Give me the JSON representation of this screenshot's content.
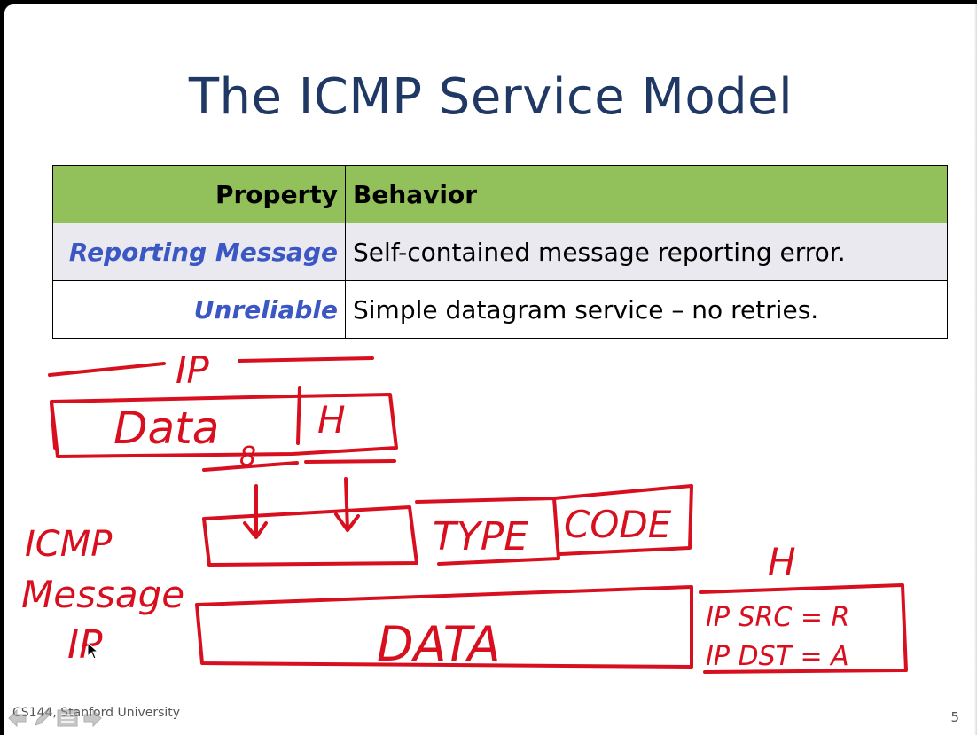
{
  "slide": {
    "title": "The ICMP Service Model",
    "table": {
      "headers": [
        "Property",
        "Behavior"
      ],
      "rows": [
        {
          "property": "Reporting Message",
          "behavior": "Self-contained message reporting error."
        },
        {
          "property": "Unreliable",
          "behavior": "Simple datagram service – no retries."
        }
      ]
    },
    "footer": "CS144, Stanford University",
    "page_number": "5"
  },
  "colors": {
    "title": "#1f3864",
    "header_bg": "#92c05a",
    "property_text": "#3b57c4",
    "row_shade": "#e9e9ef",
    "ink": "#d80f1e"
  },
  "annotations": {
    "ip_label": "IP",
    "data_label": "Data",
    "header_label": "H",
    "eight": "8",
    "type_label": "TYPE",
    "code_label": "CODE",
    "icmp_label": "ICMP",
    "message_label": "Message",
    "ip_label_lower": "IP",
    "data_label_big": "DATA",
    "h_label_right": "H",
    "ip_src": "IP SRC = R",
    "ip_dst": "IP DST = A"
  }
}
